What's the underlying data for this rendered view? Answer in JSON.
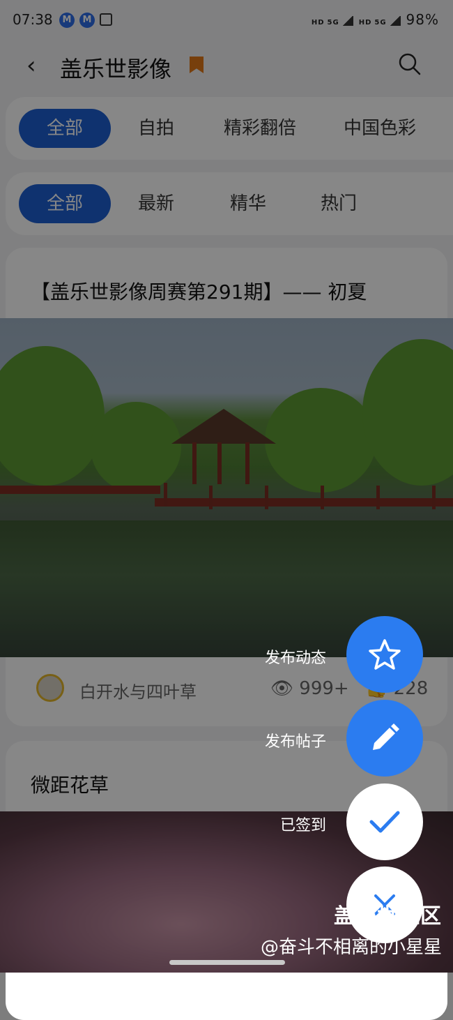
{
  "status_bar": {
    "time": "07:38",
    "badge_letter": "M",
    "network_1": "HD",
    "network_2": "5G",
    "network_3": "HD",
    "network_4": "5G",
    "battery": "98%"
  },
  "header": {
    "title": "盖乐世影像",
    "back_icon": "chevron-left-icon",
    "bookmark_icon": "bookmark-icon",
    "search_icon": "search-icon",
    "bookmark_color": "#e07818"
  },
  "category_tabs": [
    {
      "label": "全部",
      "active": true
    },
    {
      "label": "自拍",
      "active": false
    },
    {
      "label": "精彩翻倍",
      "active": false
    },
    {
      "label": "中国色彩",
      "active": false
    }
  ],
  "sort_tabs": [
    {
      "label": "全部",
      "active": true
    },
    {
      "label": "最新",
      "active": false
    },
    {
      "label": "精华",
      "active": false
    },
    {
      "label": "热门",
      "active": false
    }
  ],
  "posts": [
    {
      "title": "【盖乐世影像周赛第291期】—— 初夏",
      "author": "白开水与四叶草",
      "views": "999+",
      "likes": "228"
    },
    {
      "title": "微距花草"
    }
  ],
  "fab_menu": [
    {
      "label": "发布动态",
      "icon": "star-icon"
    },
    {
      "label": "发布帖子",
      "icon": "pencil-icon"
    },
    {
      "label": "已签到",
      "icon": "checkmark-icon"
    },
    {
      "label": "",
      "icon": "close-icon"
    }
  ],
  "watermark": {
    "line1": "盖乐世社区",
    "line2": "@奋斗不相离的小星星"
  },
  "colors": {
    "accent": "#1e5fd2",
    "fab": "#2b7cf0"
  }
}
